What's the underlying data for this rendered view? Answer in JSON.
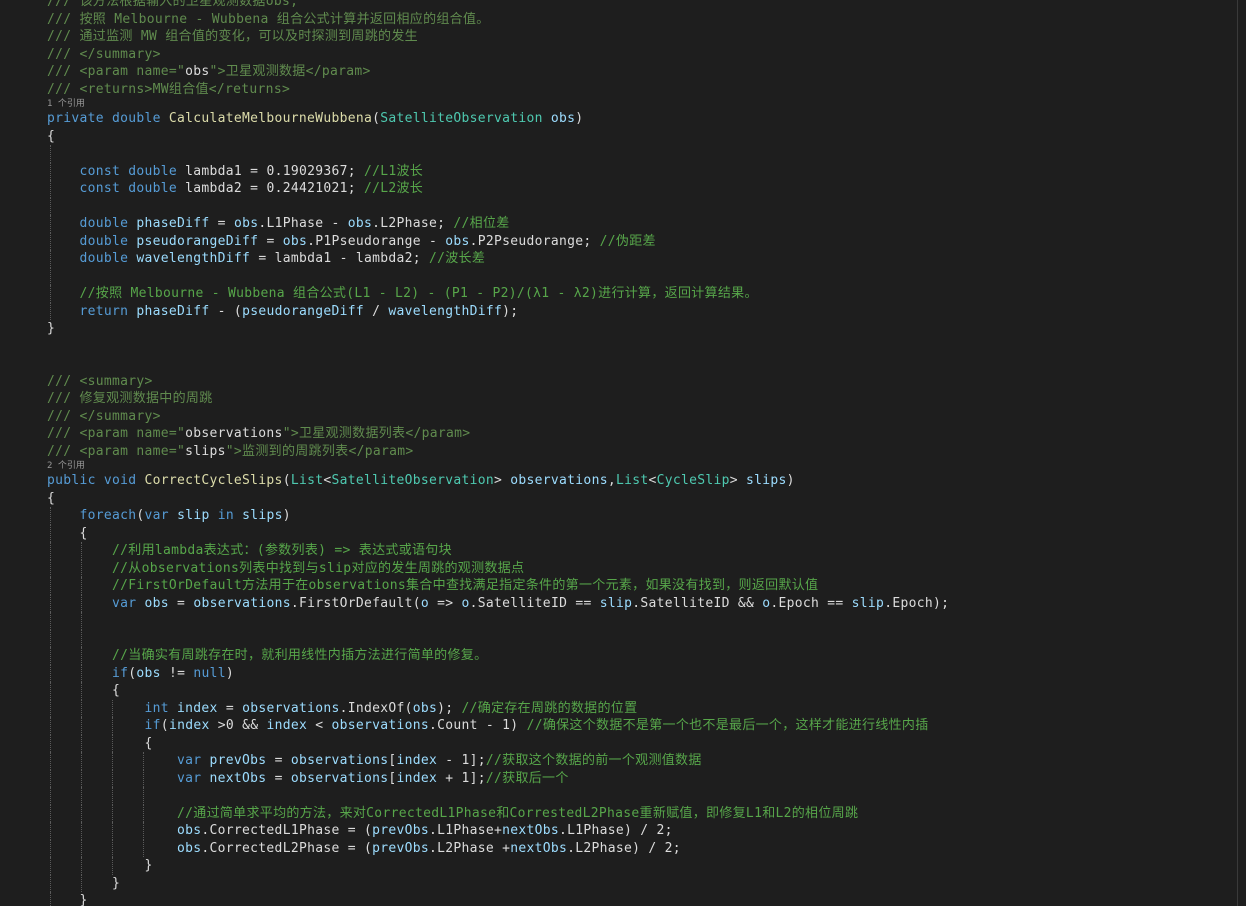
{
  "colors": {
    "background": "#1e1e1e",
    "text": "#dcdcdc",
    "keyword": "#569cd6",
    "type": "#4ec9b0",
    "method": "#dcdcaa",
    "comment": "#57a64a",
    "doc": "#608b4e",
    "doc_delim": "#808080",
    "string": "#d69d85",
    "codelens": "#999999",
    "identifier": "#9cdcfe"
  },
  "lines": [
    {
      "tokens": [
        [
          "doc",
          "/// 该方法根据输入的卫星观测数据obs,"
        ]
      ]
    },
    {
      "tokens": [
        [
          "doc",
          "/// 按照 Melbourne - Wubbena 组合公式计算并返回相应的组合值。"
        ]
      ]
    },
    {
      "tokens": [
        [
          "doc",
          "/// 通过监测 MW 组合值的变化，可以及时探测到周跳的发生"
        ]
      ]
    },
    {
      "tokens": [
        [
          "doc",
          "/// </summary>"
        ]
      ]
    },
    {
      "tokens": [
        [
          "doc",
          "/// <param name=\""
        ],
        [
          "txt",
          "obs"
        ],
        [
          "doc",
          "\">卫星观测数据</param>"
        ]
      ]
    },
    {
      "tokens": [
        [
          "doc",
          "/// <returns>MW组合值</returns>"
        ]
      ]
    },
    {
      "type": "lens",
      "text": "1 个引用"
    },
    {
      "tokens": [
        [
          "kw",
          "private double "
        ],
        [
          "mth",
          "CalculateMelbourneWubbena"
        ],
        [
          "txt",
          "("
        ],
        [
          "typ",
          "SatelliteObservation"
        ],
        [
          "txt",
          " "
        ],
        [
          "id",
          "obs"
        ],
        [
          "txt",
          ")"
        ]
      ]
    },
    {
      "tokens": [
        [
          "txt",
          "{"
        ]
      ]
    },
    {
      "tokens": [],
      "guides": 1
    },
    {
      "tokens": [
        [
          "txt",
          "    "
        ],
        [
          "kw",
          "const double "
        ],
        [
          "txt",
          "lambda1 = 0.19029367; "
        ],
        [
          "cmt",
          "//L1波长"
        ]
      ],
      "guides": 1
    },
    {
      "tokens": [
        [
          "txt",
          "    "
        ],
        [
          "kw",
          "const double "
        ],
        [
          "txt",
          "lambda2 = 0.24421021; "
        ],
        [
          "cmt",
          "//L2波长"
        ]
      ],
      "guides": 1
    },
    {
      "tokens": [],
      "guides": 1
    },
    {
      "tokens": [
        [
          "txt",
          "    "
        ],
        [
          "kw",
          "double "
        ],
        [
          "id",
          "phaseDiff"
        ],
        [
          "txt",
          " = "
        ],
        [
          "id",
          "obs"
        ],
        [
          "txt",
          ".L1Phase - "
        ],
        [
          "id",
          "obs"
        ],
        [
          "txt",
          ".L2Phase; "
        ],
        [
          "cmt",
          "//相位差"
        ]
      ],
      "guides": 1
    },
    {
      "tokens": [
        [
          "txt",
          "    "
        ],
        [
          "kw",
          "double "
        ],
        [
          "id",
          "pseudorangeDiff"
        ],
        [
          "txt",
          " = "
        ],
        [
          "id",
          "obs"
        ],
        [
          "txt",
          ".P1Pseudorange - "
        ],
        [
          "id",
          "obs"
        ],
        [
          "txt",
          ".P2Pseudorange; "
        ],
        [
          "cmt",
          "//伪距差"
        ]
      ],
      "guides": 1
    },
    {
      "tokens": [
        [
          "txt",
          "    "
        ],
        [
          "kw",
          "double "
        ],
        [
          "id",
          "wavelengthDiff"
        ],
        [
          "txt",
          " = lambda1 - lambda2; "
        ],
        [
          "cmt",
          "//波长差"
        ]
      ],
      "guides": 1
    },
    {
      "tokens": [],
      "guides": 1
    },
    {
      "tokens": [
        [
          "txt",
          "    "
        ],
        [
          "cmt",
          "//按照 Melbourne - Wubbena 组合公式(L1 - L2) - (P1 - P2)/(λ1 - λ2)进行计算，返回计算结果。"
        ]
      ],
      "guides": 1
    },
    {
      "tokens": [
        [
          "txt",
          "    "
        ],
        [
          "kw",
          "return "
        ],
        [
          "id",
          "phaseDiff"
        ],
        [
          "txt",
          " - ("
        ],
        [
          "id",
          "pseudorangeDiff"
        ],
        [
          "txt",
          " / "
        ],
        [
          "id",
          "wavelengthDiff"
        ],
        [
          "txt",
          ");"
        ]
      ],
      "guides": 1
    },
    {
      "tokens": [
        [
          "txt",
          "}"
        ]
      ]
    },
    {
      "tokens": []
    },
    {
      "tokens": []
    },
    {
      "tokens": [
        [
          "doc",
          "/// <summary>"
        ]
      ]
    },
    {
      "tokens": [
        [
          "doc",
          "/// 修复观测数据中的周跳"
        ]
      ]
    },
    {
      "tokens": [
        [
          "doc",
          "/// </summary>"
        ]
      ]
    },
    {
      "tokens": [
        [
          "doc",
          "/// <param name=\""
        ],
        [
          "txt",
          "observations"
        ],
        [
          "doc",
          "\">卫星观测数据列表</param>"
        ]
      ]
    },
    {
      "tokens": [
        [
          "doc",
          "/// <param name=\""
        ],
        [
          "txt",
          "slips"
        ],
        [
          "doc",
          "\">监测到的周跳列表</param>"
        ]
      ]
    },
    {
      "type": "lens",
      "text": "2 个引用"
    },
    {
      "tokens": [
        [
          "kw",
          "public void "
        ],
        [
          "mth",
          "CorrectCycleSlips"
        ],
        [
          "txt",
          "("
        ],
        [
          "typ",
          "List"
        ],
        [
          "txt",
          "<"
        ],
        [
          "typ",
          "SatelliteObservation"
        ],
        [
          "txt",
          "> "
        ],
        [
          "id",
          "observations"
        ],
        [
          "txt",
          ","
        ],
        [
          "typ",
          "List"
        ],
        [
          "txt",
          "<"
        ],
        [
          "typ",
          "CycleSlip"
        ],
        [
          "txt",
          "> "
        ],
        [
          "id",
          "slips"
        ],
        [
          "txt",
          ")"
        ]
      ]
    },
    {
      "tokens": [
        [
          "txt",
          "{"
        ]
      ]
    },
    {
      "tokens": [
        [
          "txt",
          "    "
        ],
        [
          "kw",
          "foreach"
        ],
        [
          "txt",
          "("
        ],
        [
          "kw",
          "var "
        ],
        [
          "id",
          "slip"
        ],
        [
          "kw",
          " in "
        ],
        [
          "id",
          "slips"
        ],
        [
          "txt",
          ")"
        ]
      ],
      "guides": 1
    },
    {
      "tokens": [
        [
          "txt",
          "    {"
        ]
      ],
      "guides": 1
    },
    {
      "tokens": [
        [
          "txt",
          "        "
        ],
        [
          "cmt",
          "//利用lambda表达式：(参数列表) => 表达式或语句块"
        ]
      ],
      "guides": 2
    },
    {
      "tokens": [
        [
          "txt",
          "        "
        ],
        [
          "cmt",
          "//从observations列表中找到与slip对应的发生周跳的观测数据点"
        ]
      ],
      "guides": 2
    },
    {
      "tokens": [
        [
          "txt",
          "        "
        ],
        [
          "cmt",
          "//FirstOrDefault方法用于在observations集合中查找满足指定条件的第一个元素，如果没有找到，则返回默认值"
        ]
      ],
      "guides": 2
    },
    {
      "tokens": [
        [
          "txt",
          "        "
        ],
        [
          "kw",
          "var "
        ],
        [
          "id",
          "obs"
        ],
        [
          "txt",
          " = "
        ],
        [
          "id",
          "observations"
        ],
        [
          "txt",
          ".FirstOrDefault("
        ],
        [
          "id",
          "o"
        ],
        [
          "txt",
          " => "
        ],
        [
          "id",
          "o"
        ],
        [
          "txt",
          ".SatelliteID == "
        ],
        [
          "id",
          "slip"
        ],
        [
          "txt",
          ".SatelliteID && "
        ],
        [
          "id",
          "o"
        ],
        [
          "txt",
          ".Epoch == "
        ],
        [
          "id",
          "slip"
        ],
        [
          "txt",
          ".Epoch);"
        ]
      ],
      "guides": 2
    },
    {
      "tokens": [],
      "guides": 2
    },
    {
      "tokens": [],
      "guides": 2
    },
    {
      "tokens": [
        [
          "txt",
          "        "
        ],
        [
          "cmt",
          "//当确实有周跳存在时，就利用线性内插方法进行简单的修复。"
        ]
      ],
      "guides": 2
    },
    {
      "tokens": [
        [
          "txt",
          "        "
        ],
        [
          "kw",
          "if"
        ],
        [
          "txt",
          "("
        ],
        [
          "id",
          "obs"
        ],
        [
          "txt",
          " != "
        ],
        [
          "kw",
          "null"
        ],
        [
          "txt",
          ")"
        ]
      ],
      "guides": 2
    },
    {
      "tokens": [
        [
          "txt",
          "        {"
        ]
      ],
      "guides": 2
    },
    {
      "tokens": [
        [
          "txt",
          "            "
        ],
        [
          "kw",
          "int "
        ],
        [
          "id",
          "index"
        ],
        [
          "txt",
          " = "
        ],
        [
          "id",
          "observations"
        ],
        [
          "txt",
          ".IndexOf("
        ],
        [
          "id",
          "obs"
        ],
        [
          "txt",
          "); "
        ],
        [
          "cmt",
          "//确定存在周跳的数据的位置"
        ]
      ],
      "guides": 3
    },
    {
      "tokens": [
        [
          "txt",
          "            "
        ],
        [
          "kw",
          "if"
        ],
        [
          "txt",
          "("
        ],
        [
          "id",
          "index"
        ],
        [
          "txt",
          " >0 && "
        ],
        [
          "id",
          "index"
        ],
        [
          "txt",
          " < "
        ],
        [
          "id",
          "observations"
        ],
        [
          "txt",
          ".Count - 1) "
        ],
        [
          "cmt",
          "//确保这个数据不是第一个也不是最后一个，这样才能进行线性内插"
        ]
      ],
      "guides": 3
    },
    {
      "tokens": [
        [
          "txt",
          "            {"
        ]
      ],
      "guides": 3
    },
    {
      "tokens": [
        [
          "txt",
          "                "
        ],
        [
          "kw",
          "var "
        ],
        [
          "id",
          "prevObs"
        ],
        [
          "txt",
          " = "
        ],
        [
          "id",
          "observations"
        ],
        [
          "txt",
          "["
        ],
        [
          "id",
          "index"
        ],
        [
          "txt",
          " - 1];"
        ],
        [
          "cmt",
          "//获取这个数据的前一个观测值数据"
        ]
      ],
      "guides": 4
    },
    {
      "tokens": [
        [
          "txt",
          "                "
        ],
        [
          "kw",
          "var "
        ],
        [
          "id",
          "nextObs"
        ],
        [
          "txt",
          " = "
        ],
        [
          "id",
          "observations"
        ],
        [
          "txt",
          "["
        ],
        [
          "id",
          "index"
        ],
        [
          "txt",
          " + 1];"
        ],
        [
          "cmt",
          "//获取后一个"
        ]
      ],
      "guides": 4
    },
    {
      "tokens": [],
      "guides": 4
    },
    {
      "tokens": [
        [
          "txt",
          "                "
        ],
        [
          "cmt",
          "//通过简单求平均的方法，来对CorrectedL1Phase和CorrestedL2Phase重新赋值，即修复L1和L2的相位周跳"
        ]
      ],
      "guides": 4
    },
    {
      "tokens": [
        [
          "txt",
          "                "
        ],
        [
          "id",
          "obs"
        ],
        [
          "txt",
          ".CorrectedL1Phase = ("
        ],
        [
          "id",
          "prevObs"
        ],
        [
          "txt",
          ".L1Phase+"
        ],
        [
          "id",
          "nextObs"
        ],
        [
          "txt",
          ".L1Phase) / 2;"
        ]
      ],
      "guides": 4
    },
    {
      "tokens": [
        [
          "txt",
          "                "
        ],
        [
          "id",
          "obs"
        ],
        [
          "txt",
          ".CorrectedL2Phase = ("
        ],
        [
          "id",
          "prevObs"
        ],
        [
          "txt",
          ".L2Phase +"
        ],
        [
          "id",
          "nextObs"
        ],
        [
          "txt",
          ".L2Phase) / 2;"
        ]
      ],
      "guides": 4
    },
    {
      "tokens": [
        [
          "txt",
          "            }"
        ]
      ],
      "guides": 3
    },
    {
      "tokens": [
        [
          "txt",
          "        }"
        ]
      ],
      "guides": 2
    },
    {
      "tokens": [
        [
          "txt",
          "    }"
        ]
      ],
      "guides": 1
    }
  ]
}
